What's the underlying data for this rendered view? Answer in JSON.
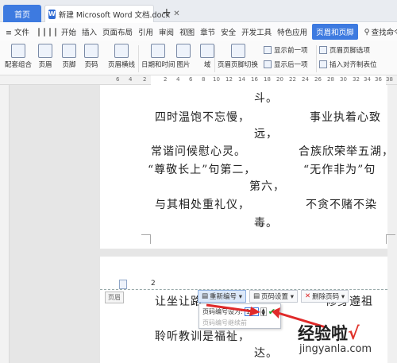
{
  "tabs": {
    "home": "首页",
    "doc_title": "新建 Microsoft Word 文档.docx",
    "close": "✕",
    "add": "+"
  },
  "menu": {
    "file": "≡ 文件",
    "items": [
      "开始",
      "插入",
      "页面布局",
      "引用",
      "审阅",
      "视图",
      "章节",
      "安全",
      "开发工具",
      "特色应用"
    ],
    "active": "页眉和页脚",
    "search": "查找命令..."
  },
  "ribbon": {
    "buttons": [
      "配套组合",
      "页眉",
      "页脚",
      "页码",
      "页眉横线",
      "日期和时间",
      "图片",
      "域",
      "页眉页脚切换"
    ],
    "show_prev": "显示前一项",
    "show_next": "显示后一项",
    "header_options": "页眉页脚选项",
    "insert_align_tab": "插入对齐制表位"
  },
  "ruler": {
    "marks": [
      "6",
      "4",
      "2",
      "2",
      "4",
      "6",
      "8",
      "10",
      "12",
      "14",
      "16",
      "18",
      "20",
      "22",
      "24",
      "26",
      "28",
      "30",
      "32",
      "34",
      "36",
      "38"
    ]
  },
  "page1": {
    "lines": [
      "斗。",
      "四时温饱不忘慢，",
      "事业执着心致",
      "远，",
      "常谐问候慰心灵。",
      "合族欣荣举五湖，",
      "“尊敬长上”句第二，",
      "“无作非为”句",
      "第六，",
      "与其相处重礼仪，",
      "不贪不赌不染",
      "毒。"
    ]
  },
  "page2": {
    "header_label": "页眉",
    "header_page_num": "2",
    "line1_left": "让坐让路",
    "line1_right": "修身遵祖",
    "line2": "聆听教训是福祉，",
    "line3": "达。"
  },
  "header_tools": {
    "renumber": "重新编号 ▾",
    "page_settings": "页码设置 ▾",
    "delete_page_num": "删除页码 ▾"
  },
  "popup": {
    "label": "页码编号设为:",
    "value": "1",
    "ok": "✔",
    "continue": "页码编号继续前"
  },
  "watermark": {
    "text": "经验啦",
    "check": "√",
    "url": "jingyanla.com"
  }
}
